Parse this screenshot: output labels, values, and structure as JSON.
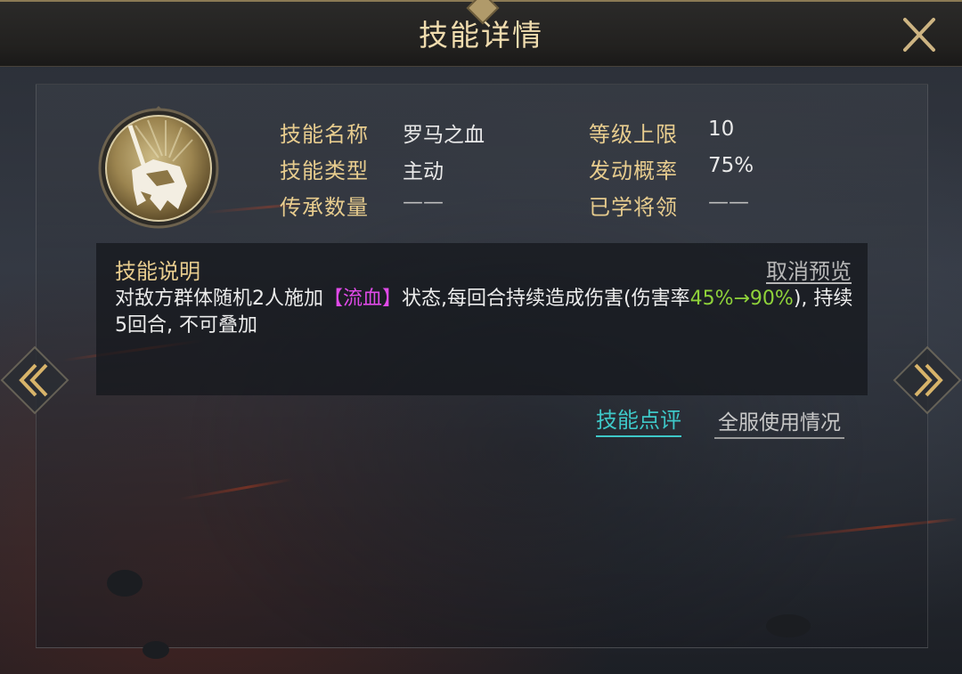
{
  "header": {
    "title": "技能详情",
    "close_icon": "close-icon"
  },
  "skill": {
    "icon": "helmet-banner-icon",
    "rows": [
      {
        "label": "技能名称",
        "value": "罗马之血"
      },
      {
        "label": "技能类型",
        "value": "主动"
      },
      {
        "label": "传承数量",
        "value": "——"
      },
      {
        "label": "等级上限",
        "value": "10"
      },
      {
        "label": "发动概率",
        "value": "75%"
      },
      {
        "label": "已学将领",
        "value": "——"
      }
    ]
  },
  "description": {
    "title": "技能说明",
    "cancel_preview": "取消预览",
    "text_before": "对敌方群体随机2人施加",
    "status_tag": "【流血】",
    "text_middle": "状态,每回合持续造成伤害(伤害率",
    "rate_change": "45%→90%",
    "text_after": "), 持续5回合, 不可叠加"
  },
  "links": {
    "review": "技能点评",
    "server_usage": "全服使用情况"
  },
  "nav": {
    "prev_icon": "double-chevron-left-icon",
    "next_icon": "double-chevron-right-icon"
  },
  "colors": {
    "label_gold": "#e7cc8e",
    "status_magenta": "#e04ae8",
    "value_green": "#8fd23a",
    "link_cyan": "#3ec8c8"
  }
}
